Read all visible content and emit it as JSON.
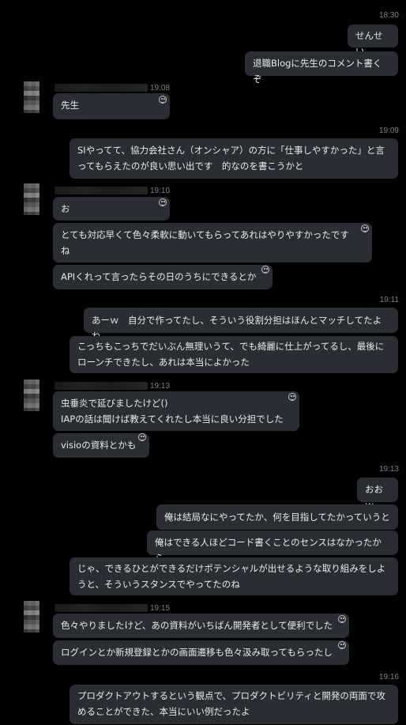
{
  "messages": {
    "t1": "18:30",
    "m1": "せんせい",
    "m2": "退職Blogに先生のコメント書くぞ",
    "t2": "19:08",
    "m3": "先生",
    "t3": "19:09",
    "m4": "SIやってて、協力会社さん（オンシャア）の方に「仕事しやすかった」と言\nってもらえたのが良い思い出です　的なのを書こうかと",
    "t4": "19:10",
    "m5": "お",
    "m6": "とても対応早くて色々柔軟に動いてもらってあれはやりやすかったです\nね",
    "m7": "APIくれって言ったらその日のうちにできるとか",
    "t5": "19:11",
    "m8": "あーｗ　自分で作ってたし、そういう役割分担はほんとマッチしてたよね",
    "m9": "こっちもこっちでだいぶん無理いうて、でも綺麗に仕上がってるし、最後に\nローンチできたし、あれは本当によかった",
    "t6": "19:13",
    "m10": "虫垂炎で延びましたけど()\nIAPの話は聞けば教えてくれたし本当に良い分担でした",
    "m11": "visioの資料とかも",
    "t7": "19:13",
    "m12": "おおｗ",
    "m13": "俺は結局なにやってたか、何を目指してたかっていうと",
    "m14": "俺はできる人ほどコード書くことのセンスはなかったから",
    "m15": "じゃ、できるひとができるだけポテンシャルが出せるような取り組みをしよ\nうと、そういうスタンスでやってたのね",
    "t8": "19:15",
    "m16": "色々やりましたけど、あの資料がいちばん開発者として便利でした",
    "m17": "ログインとか新規登録とかの画面遷移も色々汲み取ってもらったし",
    "t9": "19:16",
    "m18": "プロダクトアウトするという観点で、プロダクトビリティと開発の両面で攻\nめることができた、本当にいい例だったよ"
  }
}
